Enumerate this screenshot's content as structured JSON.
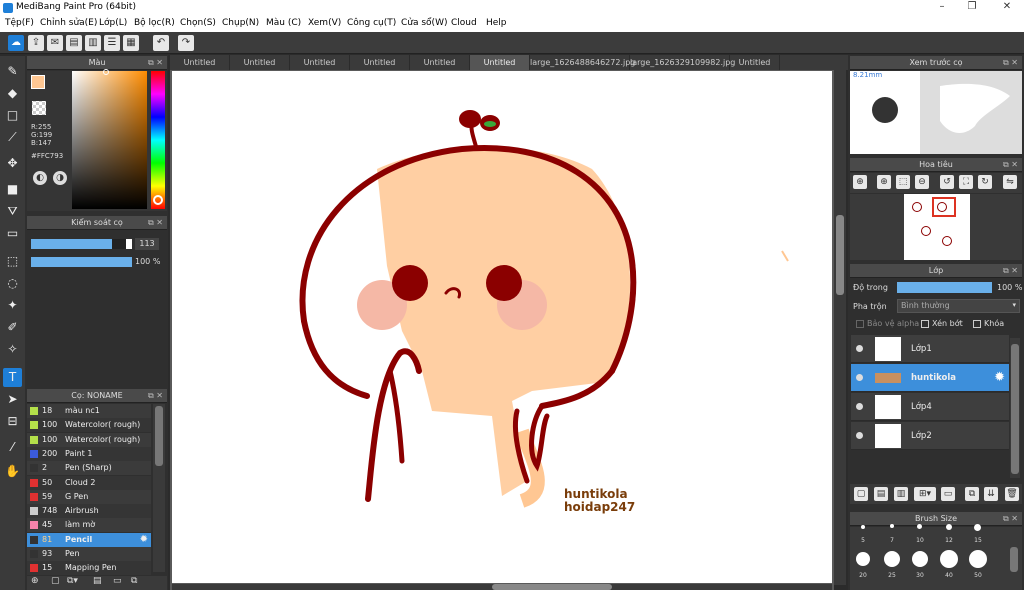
{
  "window": {
    "title": "MediBang Paint Pro (64bit)"
  },
  "menu": [
    "Tệp(F)",
    "Chỉnh sửa(E)",
    "Lớp(L)",
    "Bộ lọc(R)",
    "Chọn(S)",
    "Chụp(N)",
    "Màu (C)",
    "Xem(V)",
    "Công cụ(T)",
    "Cửa sổ(W)",
    "Cloud",
    "Help"
  ],
  "color_panel": {
    "title": "Màu",
    "r": "R:255",
    "g": "G:199",
    "b": "B:147",
    "hex": "#FFC793",
    "current_color": "#FFC793"
  },
  "brush_control": {
    "title": "Kiểm soát cọ",
    "size": "113",
    "opacity": "100 %",
    "size_fraction": 0.8,
    "opacity_fraction": 1.0
  },
  "brush_list": {
    "title": "Cọ: NONAME",
    "items": [
      {
        "size": "18",
        "name": "màu nc1",
        "color": "#b4e04a"
      },
      {
        "size": "100",
        "name": "Watercolor( rough)",
        "color": "#b4e04a"
      },
      {
        "size": "100",
        "name": "Watercolor( rough)",
        "color": "#b4e04a"
      },
      {
        "size": "200",
        "name": "Paint 1",
        "color": "#3b5bdb"
      },
      {
        "size": "2",
        "name": "Pen (Sharp)",
        "color": "#333333"
      },
      {
        "size": "50",
        "name": "Cloud 2",
        "color": "#e03131"
      },
      {
        "size": "59",
        "name": "G Pen",
        "color": "#e03131"
      },
      {
        "size": "748",
        "name": "Airbrush",
        "color": "#cccccc"
      },
      {
        "size": "45",
        "name": "làm mờ",
        "color": "#f783ac"
      },
      {
        "size": "81",
        "name": "Pencil",
        "color": "#333333"
      },
      {
        "size": "93",
        "name": "Pen",
        "color": "#333333"
      },
      {
        "size": "15",
        "name": "Mapping Pen",
        "color": "#e03131"
      }
    ]
  },
  "tabs": [
    "Untitled",
    "Untitled",
    "Untitled",
    "Untitled",
    "Untitled",
    "Untitled",
    "large_1626488646272.jpg",
    "large_1626329109982.jpg",
    "Untitled"
  ],
  "canvas": {
    "watermark_line1": "huntikola",
    "watermark_line2": "hoidap247"
  },
  "preview": {
    "title": "Xem trước cọ",
    "size": "8.21mm"
  },
  "navigator": {
    "title": "Hoa tiêu"
  },
  "layers_panel": {
    "title": "Lớp",
    "opacity_label": "Độ trong",
    "opacity_value": "100 %",
    "blend_label": "Pha trộn",
    "blend_value": "Bình thường",
    "protect_alpha": "Bảo vệ alpha",
    "clipping": "Xén bớt",
    "lock": "Khóa",
    "layers": [
      "Lớp1",
      "huntikola",
      "Lớp4",
      "Lớp2"
    ]
  },
  "brush_size": {
    "title": "Brush Size",
    "sizes": [
      "20",
      "25",
      "30",
      "40",
      "50"
    ],
    "row1_labels": [
      "5",
      "7",
      "10",
      "12",
      "15"
    ]
  }
}
